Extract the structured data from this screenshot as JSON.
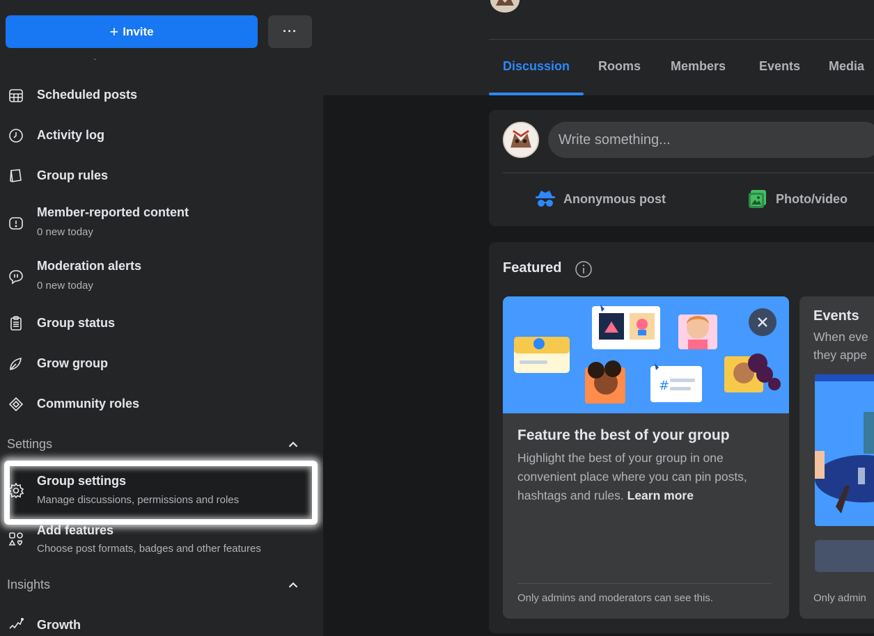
{
  "sidebar": {
    "invite_label": "Invite",
    "more_label": "···",
    "items": [
      {
        "label": "Scheduled posts",
        "sub": "",
        "icon": "calendar-grid-icon"
      },
      {
        "label": "Activity log",
        "sub": "",
        "icon": "clock-icon"
      },
      {
        "label": "Group rules",
        "sub": "",
        "icon": "book-icon"
      },
      {
        "label": "Member-reported content",
        "sub": "0 new today",
        "icon": "report-icon"
      },
      {
        "label": "Moderation alerts",
        "sub": "0 new today",
        "icon": "alert-bubble-icon"
      },
      {
        "label": "Group status",
        "sub": "",
        "icon": "clipboard-icon"
      },
      {
        "label": "Grow group",
        "sub": "",
        "icon": "grow-icon"
      },
      {
        "label": "Community roles",
        "sub": "",
        "icon": "diamond-icon"
      }
    ],
    "settings": {
      "title": "Settings",
      "items": [
        {
          "label": "Group settings",
          "sub": "Manage discussions, permissions and roles",
          "icon": "gear-icon"
        },
        {
          "label": "Add features",
          "sub": "Choose post formats, badges and other features",
          "icon": "shapes-icon"
        }
      ]
    },
    "insights": {
      "title": "Insights",
      "items": [
        {
          "label": "Growth",
          "sub": "",
          "icon": "growth-chart-icon"
        }
      ]
    }
  },
  "tabs": [
    "Discussion",
    "Rooms",
    "Members",
    "Events",
    "Media"
  ],
  "composer": {
    "placeholder": "Write something...",
    "actions": [
      {
        "label": "Anonymous post",
        "icon": "anonymous-icon"
      },
      {
        "label": "Photo/video",
        "icon": "photo-video-icon"
      }
    ]
  },
  "featured": {
    "title": "Featured",
    "card1": {
      "heading": "Feature the best of your group",
      "body": "Highlight the best of your group in one convenient place where you can pin posts, hashtags and rules.",
      "link": "Learn more",
      "footer": "Only admins and moderators can see this."
    },
    "card2": {
      "heading": "Events",
      "line1": "When eve",
      "line2": "they appe",
      "footer": "Only admin"
    }
  },
  "colors": {
    "accent": "#2d88ff",
    "primary_button": "#1877f2",
    "panel": "#242526",
    "background": "#18191a"
  }
}
